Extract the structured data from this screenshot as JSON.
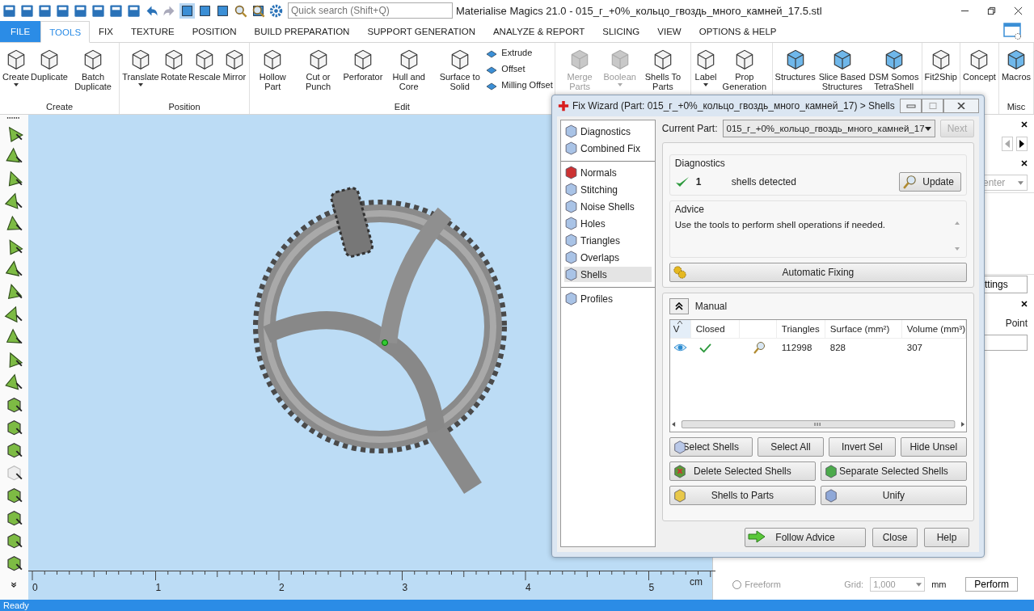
{
  "window": {
    "title": "Materialise Magics 21.0 - 015_г_+0%_кольцо_гвоздь_много_камней_17.5.stl"
  },
  "search": {
    "placeholder": "Quick search (Shift+Q)"
  },
  "tabs": [
    {
      "label": "FILE",
      "kind": "file",
      "selected": false
    },
    {
      "label": "TOOLS",
      "kind": "tab",
      "selected": true
    },
    {
      "label": "FIX",
      "kind": "tab",
      "selected": false
    },
    {
      "label": "TEXTURE",
      "kind": "tab",
      "selected": false
    },
    {
      "label": "POSITION",
      "kind": "tab",
      "selected": false
    },
    {
      "label": "BUILD PREPARATION",
      "kind": "tab",
      "selected": false
    },
    {
      "label": "SUPPORT GENERATION",
      "kind": "tab",
      "selected": false
    },
    {
      "label": "ANALYZE & REPORT",
      "kind": "tab",
      "selected": false
    },
    {
      "label": "SLICING",
      "kind": "tab",
      "selected": false
    },
    {
      "label": "VIEW",
      "kind": "tab",
      "selected": false
    },
    {
      "label": "OPTIONS & HELP",
      "kind": "tab",
      "selected": false
    }
  ],
  "ribbon": [
    {
      "label": "Create",
      "items": [
        {
          "label": "Create",
          "disabled": false,
          "dropdown": true
        },
        {
          "label": "Duplicate",
          "disabled": false,
          "dropdown": false
        },
        {
          "label": "Batch Duplicate",
          "disabled": false,
          "dropdown": false
        }
      ]
    },
    {
      "label": "Position",
      "items": [
        {
          "label": "Translate",
          "disabled": false,
          "dropdown": true
        },
        {
          "label": "Rotate",
          "disabled": false,
          "dropdown": false
        },
        {
          "label": "Rescale",
          "disabled": false,
          "dropdown": false
        },
        {
          "label": "Mirror",
          "disabled": false,
          "dropdown": false
        }
      ]
    },
    {
      "label": "Edit",
      "items": [
        {
          "label": "Hollow Part",
          "disabled": false,
          "dropdown": false
        },
        {
          "label": "Cut or Punch",
          "disabled": false,
          "dropdown": false
        },
        {
          "label": "Perforator",
          "disabled": false,
          "dropdown": false
        },
        {
          "label": "Hull and Core",
          "disabled": false,
          "dropdown": false
        },
        {
          "label": "Surface to Solid",
          "disabled": false,
          "dropdown": false
        }
      ],
      "small": [
        "Extrude",
        "Offset",
        "Milling Offset"
      ]
    },
    {
      "items": [
        {
          "label": "Merge Parts",
          "disabled": true,
          "dropdown": false
        },
        {
          "label": "Boolean",
          "disabled": true,
          "dropdown": true
        },
        {
          "label": "Shells To Parts",
          "disabled": false,
          "dropdown": false
        }
      ]
    },
    {
      "items": [
        {
          "label": "Label",
          "disabled": false,
          "dropdown": true
        },
        {
          "label": "Prop Generation",
          "disabled": false,
          "dropdown": false
        }
      ]
    },
    {
      "items": [
        {
          "label": "Structures",
          "disabled": false,
          "dropdown": false
        },
        {
          "label": "Slice Based Structures",
          "disabled": false,
          "dropdown": false
        },
        {
          "label": "DSM Somos TetraShell",
          "disabled": false,
          "dropdown": false
        }
      ]
    },
    {
      "items": [
        {
          "label": "Fit2Ship",
          "disabled": false,
          "dropdown": false
        }
      ]
    },
    {
      "items": [
        {
          "label": "Concept",
          "disabled": false,
          "dropdown": false
        }
      ]
    },
    {
      "label": "Misc",
      "items": [
        {
          "label": "Macros",
          "disabled": false,
          "dropdown": false
        }
      ]
    }
  ],
  "ruler": {
    "labels": [
      "0",
      "1",
      "2",
      "3",
      "4",
      "5"
    ],
    "unit": "cm"
  },
  "side_panel": {
    "dropdown_fragment": "enter",
    "button_fragment": "ttings",
    "point_label": "Point",
    "freeform": {
      "label": "Freeform",
      "selected": false
    },
    "grid_label": "Grid:",
    "grid_value": "1,000",
    "grid_unit": "mm",
    "perform": "Perform"
  },
  "dialog": {
    "title": "Fix Wizard (Part: 015_г_+0%_кольцо_гвоздь_много_камней_17) > Shells",
    "nav": [
      [
        {
          "label": "Diagnostics",
          "selected": false
        },
        {
          "label": "Combined Fix",
          "selected": false
        }
      ],
      [
        {
          "label": "Normals",
          "selected": false
        },
        {
          "label": "Stitching",
          "selected": false
        },
        {
          "label": "Noise Shells",
          "selected": false
        },
        {
          "label": "Holes",
          "selected": false
        },
        {
          "label": "Triangles",
          "selected": false
        },
        {
          "label": "Overlaps",
          "selected": false
        },
        {
          "label": "Shells",
          "selected": true
        }
      ],
      [
        {
          "label": "Profiles",
          "selected": false
        }
      ]
    ],
    "current_part_label": "Current Part:",
    "current_part": "015_г_+0%_кольцо_гвоздь_много_камней_17",
    "next": {
      "label": "Next",
      "disabled": true
    },
    "diagnostics": {
      "title": "Diagnostics",
      "ok": true,
      "count": "1",
      "text": "shells detected",
      "button": "Update"
    },
    "advice": {
      "title": "Advice",
      "text": "Use the tools to perform shell operations if needed."
    },
    "auto_fix": "Automatic Fixing",
    "manual": {
      "label": "Manual",
      "expanded": true
    },
    "table": {
      "columns": [
        {
          "kind": "text",
          "label": "V",
          "sorted": true
        },
        {
          "kind": "text",
          "label": "Closed",
          "sorted": false
        },
        {
          "kind": "blank",
          "sorted": false
        },
        {
          "kind": "text",
          "label": "Triangles",
          "sorted": false
        },
        {
          "kind": "text",
          "label": "Surface (mm²)",
          "sorted": false
        },
        {
          "kind": "text",
          "label": "Volume (mm³)",
          "sorted": false
        }
      ],
      "rows": [
        {
          "visible": true,
          "closed": true,
          "triangles": "112998",
          "surface": "828",
          "volume": "307"
        }
      ]
    },
    "button_rows": [
      [
        "Select Shells",
        "Select All",
        "Invert Sel",
        "Hide Unsel"
      ],
      [
        "Delete Selected Shells",
        "Separate Selected Shells"
      ],
      [
        "Shells to Parts",
        "Unify"
      ]
    ],
    "footer": [
      "Follow Advice",
      "Close",
      "Help"
    ]
  },
  "status_bar": {
    "text": "Ready"
  }
}
